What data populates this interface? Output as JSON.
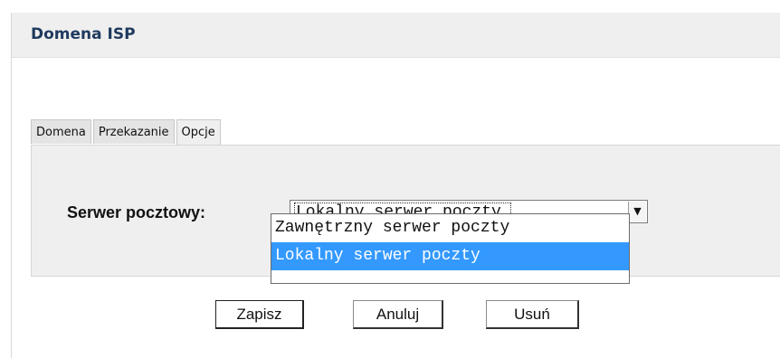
{
  "panel": {
    "title": "Domena ISP"
  },
  "tabs": [
    {
      "label": "Domena",
      "active": false
    },
    {
      "label": "Przekazanie",
      "active": false
    },
    {
      "label": "Opcje",
      "active": true
    }
  ],
  "form": {
    "mail_server_label": "Serwer pocztowy:",
    "mail_server_selected": "Lokalny serwer poczty",
    "mail_server_options": [
      {
        "label": "Zawnętrzny serwer poczty",
        "highlighted": false
      },
      {
        "label": "Lokalny serwer poczty",
        "highlighted": true
      }
    ],
    "dropdown_arrow_icon": "chevron-down-icon"
  },
  "actions": {
    "save_label": "Zapisz",
    "cancel_label": "Anuluj",
    "delete_label": "Usuń"
  },
  "colors": {
    "header_bg": "#efefef",
    "title_text": "#1f3a5f",
    "tab_content_bg": "#efefef",
    "highlight": "#3399ff"
  }
}
